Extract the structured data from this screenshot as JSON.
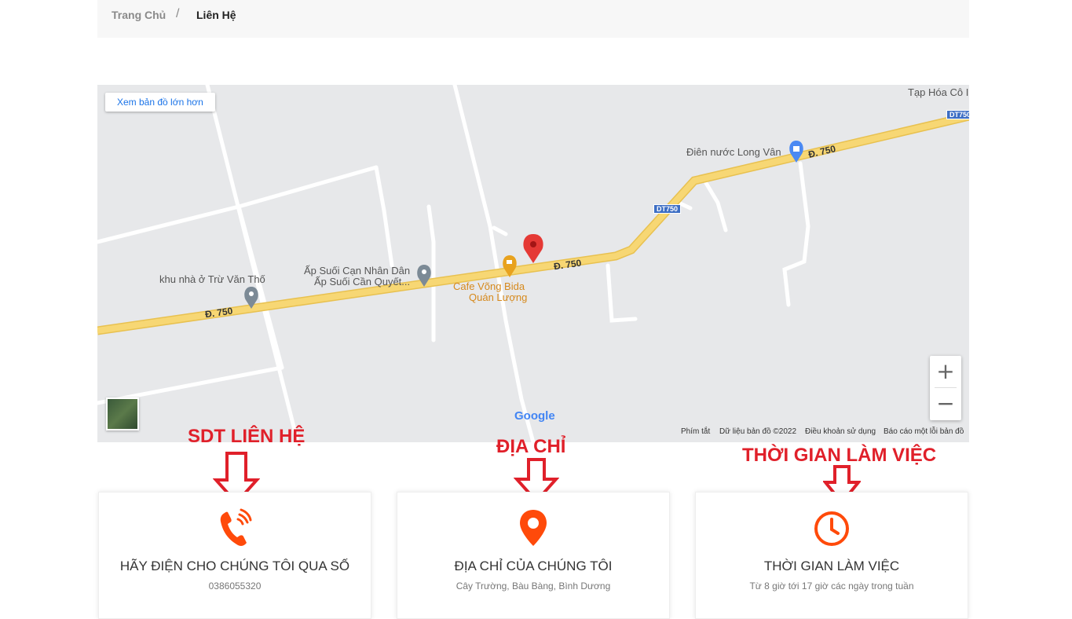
{
  "breadcrumb": {
    "home": "Trang Chủ",
    "separator": "/",
    "current": "Liên Hệ"
  },
  "map": {
    "view_larger_link": "Xem bản đồ lớn hơn",
    "labels": {
      "shop_top_right": "Tạp Hóa Cô I",
      "electric_store": "Điên nước Long Vân",
      "hamlet_line1": "Ấp Suối Cạn Nhân Dân",
      "hamlet_line2": "Ấp Suối Cần Quyết...",
      "house": "khu nhà ở Trừ Văn Thố",
      "cafe_line1": "Cafe Võng Bida",
      "cafe_line2": "Quán Lượng"
    },
    "road_labels": {
      "road_left": "Đ. 750",
      "road_mid": "Đ. 750",
      "road_right": "Đ. 750"
    },
    "dt_badges": {
      "upper": "DT750",
      "lower": "DT750"
    },
    "zoom": {
      "in": "+",
      "out": "−"
    },
    "google": "Google",
    "attribution": {
      "shortcuts": "Phím tắt",
      "data": "Dữ liệu bản đồ ©2022",
      "terms": "Điều khoản sử dụng",
      "report": "Báo cáo một lỗi bản đồ"
    }
  },
  "annotations": {
    "phone": "SDT LIÊN HỆ",
    "address": "ĐỊA CHỈ",
    "hours": "THỜI GIAN LÀM VIỆC"
  },
  "cards": {
    "phone": {
      "icon": "phone-ringing-icon",
      "title": "HÃY ĐIỆN CHO CHÚNG TÔI QUA SỐ",
      "text": "0386055320"
    },
    "address": {
      "icon": "location-pin-icon",
      "title": "ĐỊA CHỈ CỦA CHÚNG TÔI",
      "text": "Cây Trường, Bàu Bàng, Bình Dương"
    },
    "hours": {
      "icon": "clock-icon",
      "title": "THỜI GIAN LÀM VIỆC",
      "text": "Từ 8 giờ tới 17 giờ các ngày trong tuần"
    }
  },
  "colors": {
    "accent": "#ff4a0a",
    "annotation": "#e0202a",
    "road": "#f7d774",
    "map_bg": "#e7e8ea",
    "pin": "#e53935"
  }
}
